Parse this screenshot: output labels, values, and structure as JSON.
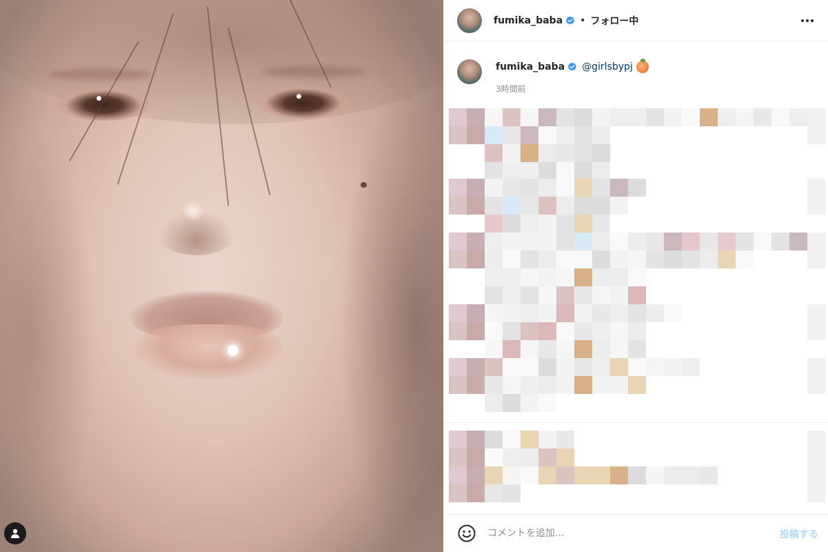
{
  "post": {
    "image_alt": "",
    "user_tag_icon": "person-icon"
  },
  "header": {
    "username": "fumika_baba",
    "verified": true,
    "separator": "•",
    "follow_status": "フォロー中",
    "more_icon": "more-horizontal-icon"
  },
  "caption": {
    "username": "fumika_baba",
    "mention": "@girlsbypj",
    "emoji": "peach-emoji",
    "timestamp": "3時間前"
  },
  "comment_box": {
    "emoji_icon": "smiley-icon",
    "placeholder": "コメントを追加...",
    "post_label": "投稿する"
  },
  "colors": {
    "verified_blue": "#3897f0",
    "post_button_disabled": "#b3dbff",
    "mention_link": "#00376b",
    "secondary_text": "#8e8e8e"
  }
}
